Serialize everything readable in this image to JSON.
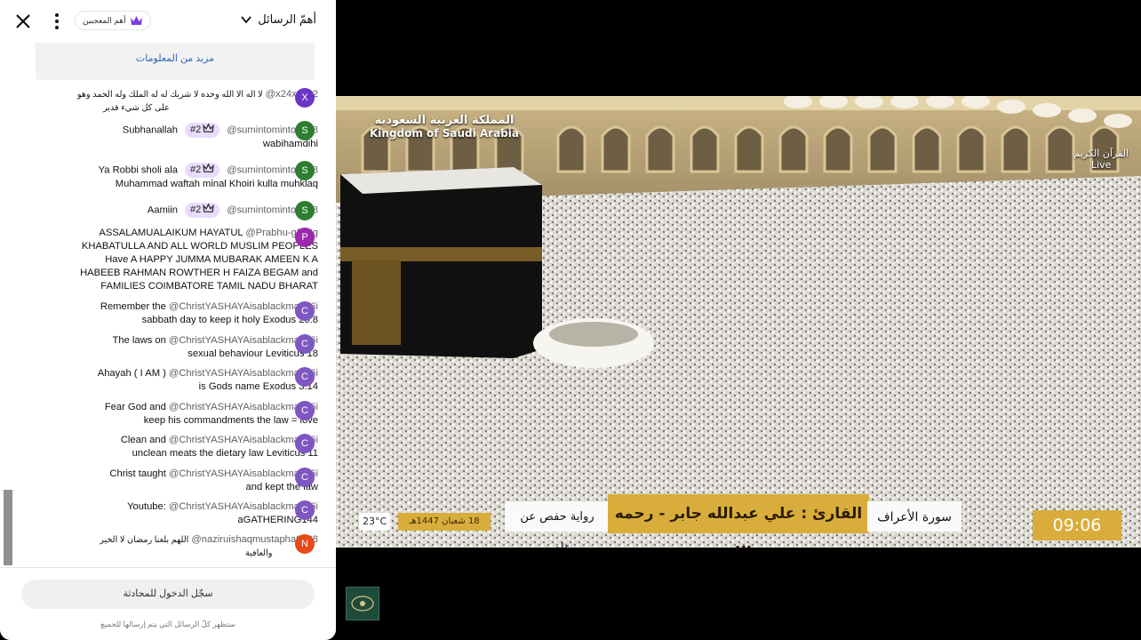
{
  "header": {
    "title": "أهمّ الرسائل",
    "badge_label": "أهم المعجبين"
  },
  "info": {
    "link": "مزيد من المعلومات"
  },
  "messages": [
    {
      "author": "@x24x25x2",
      "avatar": "X",
      "color": "#6b35c6",
      "rank": "",
      "line1": "لا اله الا الله وحده لا شريك له له الملك وله الحمد وهو",
      "line2": "على كل شيء قدير"
    },
    {
      "author": "@sumintominto8698",
      "avatar": "S",
      "color": "#2e7d32",
      "rank": "#2",
      "line1": "Subhanallah",
      "line2": "wabihamdihi"
    },
    {
      "author": "@sumintominto8698",
      "avatar": "S",
      "color": "#2e7d32",
      "rank": "#2",
      "line1": "Ya Robbi sholi ala",
      "line2": "Muhammad waftah minal Khoiri kulla muhklaq"
    },
    {
      "author": "@sumintominto8698",
      "avatar": "S",
      "color": "#2e7d32",
      "rank": "#2",
      "line1": "Aamiin",
      "line2": ""
    },
    {
      "author": "@Prabhu-g5k6g",
      "avatar": "P",
      "color": "#9c27b0",
      "rank": "",
      "line1": "ASSALAMUALAIKUM HAYATUL",
      "line2": "KHABATULLA AND ALL WORLD MUSLIM PEOPLES",
      "line3": "Have A HAPPY JUMMA MUBARAK AMEEN K A",
      "line4": "HABEEB RAHMAN ROWTHER H FAIZA BEGAM and",
      "line5": "FAMILIES COIMBATORE TAMIL NADU BHARAT"
    },
    {
      "author": "@ChristYASHAYAisablackman-l6i",
      "avatar": "C",
      "color": "#7e57c2",
      "rank": "",
      "line1": "Remember the",
      "line2": "sabbath day to keep it holy Exodus 20:8"
    },
    {
      "author": "@ChristYASHAYAisablackman-l6i",
      "avatar": "C",
      "color": "#7e57c2",
      "rank": "",
      "line1": "The laws on",
      "line2": "sexual behaviour Leviticus 18"
    },
    {
      "author": "@ChristYASHAYAisablackman-l6i",
      "avatar": "C",
      "color": "#7e57c2",
      "rank": "",
      "line1": "Ahayah ( I AM )",
      "line2": "is Gods name Exodus 3:14"
    },
    {
      "author": "@ChristYASHAYAisablackman-l6i",
      "avatar": "C",
      "color": "#7e57c2",
      "rank": "",
      "line1": "Fear God and",
      "line2": "keep his commandments the law = love"
    },
    {
      "author": "@ChristYASHAYAisablackman-l6i",
      "avatar": "C",
      "color": "#7e57c2",
      "rank": "",
      "line1": "Clean and",
      "line2": "unclean meats the dietary law Leviticus 11"
    },
    {
      "author": "@ChristYASHAYAisablackman-l6i",
      "avatar": "C",
      "color": "#7e57c2",
      "rank": "",
      "line1": "Christ taught",
      "line2": "and kept the law"
    },
    {
      "author": "@ChristYASHAYAisablackman-l6i",
      "avatar": "C",
      "color": "#7e57c2",
      "rank": "",
      "line1": "Youtube:",
      "line2": "aGATHERING144"
    },
    {
      "author": "@naziruishaqmustapha9028",
      "avatar": "N",
      "color": "#e64a19",
      "rank": "",
      "line1": "اللهم بلغنا رمضان لا الخير",
      "line2": "والعافية"
    }
  ],
  "footer": {
    "signin": "سجّل الدخول للمحادثة",
    "note": "ستظهر كلّ الرسائل التي يتم إرسالها للجميع"
  },
  "video": {
    "channel_ar": "المملكة العربية السعودية",
    "channel_en": "Kingdom of Saudi Arabia",
    "live_ar": "القرآن الكريم",
    "live_en": "Live",
    "surah": "سورة الأعراف",
    "reciter": "القارئ : علي عبدالله جابر - رحمه الله",
    "narration": "رواية حفص عن عاصم",
    "date": "18 شعبان 1447هـ",
    "temp": "23°C",
    "time": "09:06"
  },
  "colors": {
    "accent": "#eadcff",
    "link": "#3167b7",
    "gold": "#d9ad3c"
  }
}
